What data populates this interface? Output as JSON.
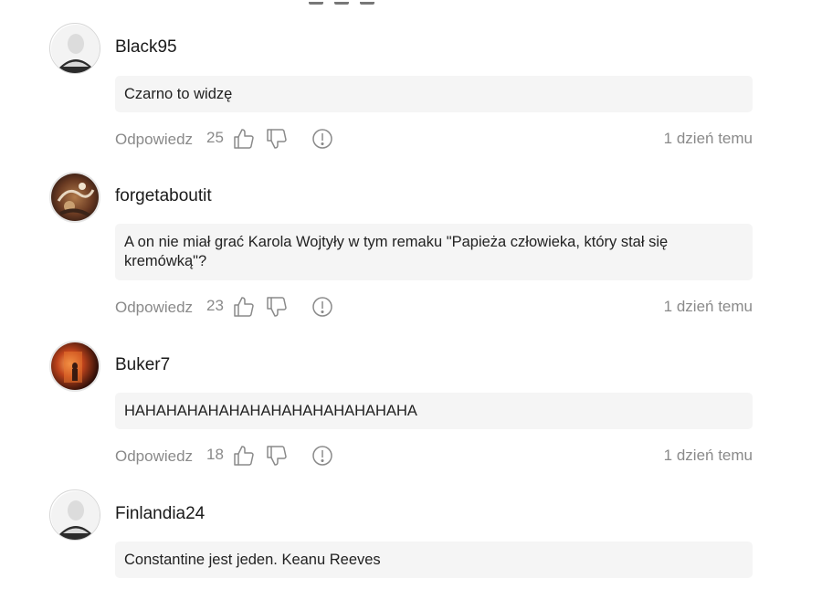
{
  "comments": [
    {
      "username": "Black95",
      "avatar": "default-avatar-icon",
      "text": "Czarno to widzę",
      "reply_label": "Odpowiedz",
      "score": "25",
      "time": "1 dzień temu"
    },
    {
      "username": "forgetaboutit",
      "avatar": "user-photo-avatar",
      "text": "A on nie miał grać Karola Wojtyły w tym remaku \"Papieża człowieka, który stał się kremówką\"?",
      "reply_label": "Odpowiedz",
      "score": "23",
      "time": "1 dzień temu"
    },
    {
      "username": "Buker7",
      "avatar": "user-photo-avatar",
      "text": "HAHAHAHAHAHAHAHAHAHAHAHAHAHA",
      "reply_label": "Odpowiedz",
      "score": "18",
      "time": "1 dzień temu"
    },
    {
      "username": "Finlandia24",
      "avatar": "default-avatar-icon",
      "text": "Constantine jest jeden. Keanu Reeves"
    }
  ],
  "icons": {
    "like": "thumbs-up-icon",
    "dislike": "thumbs-down-icon",
    "report": "report-exclamation-icon"
  },
  "colors": {
    "bubble_bg": "#f5f5f5",
    "muted_text": "#8a8a8a",
    "body_text": "#222222"
  }
}
